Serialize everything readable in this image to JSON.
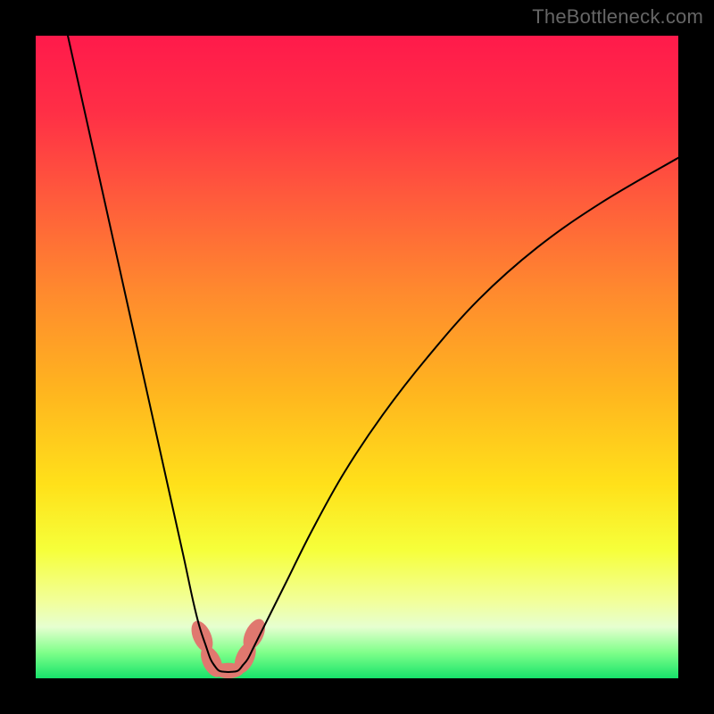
{
  "watermark": "TheBottleneck.com",
  "chart_data": {
    "type": "line",
    "title": "",
    "xlabel": "",
    "ylabel": "",
    "xlim": [
      0,
      100
    ],
    "ylim": [
      0,
      100
    ],
    "gradient_stops": [
      {
        "offset": 0.0,
        "color": "#ff1a4b"
      },
      {
        "offset": 0.12,
        "color": "#ff2f46"
      },
      {
        "offset": 0.25,
        "color": "#ff5a3c"
      },
      {
        "offset": 0.4,
        "color": "#ff8a2e"
      },
      {
        "offset": 0.55,
        "color": "#ffb41f"
      },
      {
        "offset": 0.7,
        "color": "#ffe11a"
      },
      {
        "offset": 0.8,
        "color": "#f6ff3a"
      },
      {
        "offset": 0.88,
        "color": "#f2ff9a"
      },
      {
        "offset": 0.92,
        "color": "#e6ffd0"
      },
      {
        "offset": 0.96,
        "color": "#7fff8a"
      },
      {
        "offset": 1.0,
        "color": "#17e36a"
      }
    ],
    "series": [
      {
        "name": "left-arm",
        "x": [
          5,
          7,
          9,
          11,
          13,
          15,
          17,
          19,
          21,
          23,
          24.5,
          25.5,
          26.5,
          27.2,
          27.8
        ],
        "y": [
          100,
          91,
          82,
          73,
          64,
          55,
          46,
          37,
          28,
          19,
          12,
          8,
          5,
          3,
          2
        ]
      },
      {
        "name": "right-arm",
        "x": [
          32.2,
          33,
          34,
          36,
          39,
          43,
          48,
          54,
          61,
          69,
          78,
          88,
          100
        ],
        "y": [
          2,
          3,
          5,
          9,
          15,
          23,
          32,
          41,
          50,
          59,
          67,
          74,
          81
        ]
      },
      {
        "name": "valley-floor",
        "x": [
          27.8,
          28.5,
          29.5,
          30.5,
          31.5,
          32.2
        ],
        "y": [
          2,
          1.2,
          1,
          1,
          1.2,
          2
        ]
      }
    ],
    "markers": [
      {
        "cx": 25.9,
        "cy": 6.5,
        "rx": 1.4,
        "ry": 2.6,
        "angle": -24,
        "color": "#e0786f"
      },
      {
        "cx": 27.4,
        "cy": 2.6,
        "rx": 1.4,
        "ry": 2.6,
        "angle": -26,
        "color": "#e0786f"
      },
      {
        "cx": 30.0,
        "cy": 1.2,
        "rx": 2.4,
        "ry": 1.2,
        "angle": 0,
        "color": "#e0786f"
      },
      {
        "cx": 32.6,
        "cy": 3.2,
        "rx": 1.4,
        "ry": 2.6,
        "angle": 24,
        "color": "#e0786f"
      },
      {
        "cx": 34.0,
        "cy": 6.8,
        "rx": 1.4,
        "ry": 2.6,
        "angle": 26,
        "color": "#e0786f"
      }
    ]
  }
}
